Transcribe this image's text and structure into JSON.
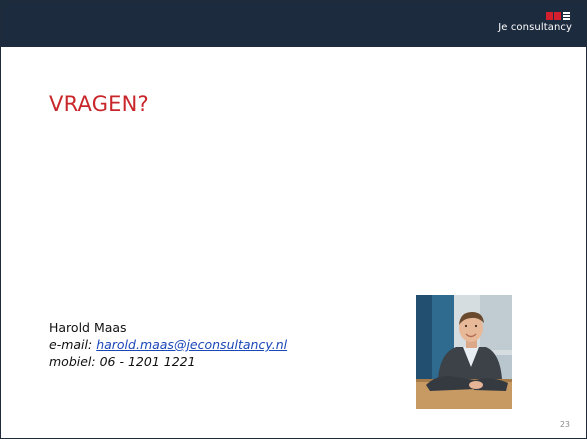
{
  "slide": {
    "logo_text": "Je consultancy",
    "title": "VRAGEN?",
    "contact": {
      "name": "Harold Maas",
      "email_label": "e-mail:",
      "email": "harold.maas@jeconsultancy.nl",
      "phone_label": "mobiel:",
      "phone": "06 - 1201 1221"
    },
    "page_number": "23"
  },
  "colors": {
    "header": "#1d2b3f",
    "title": "#c8262a",
    "logo_accent": "#d41f2f",
    "link": "#1a47b8"
  },
  "icons": {
    "logo": "je-consultancy-logo",
    "photo": "portrait-photo"
  }
}
